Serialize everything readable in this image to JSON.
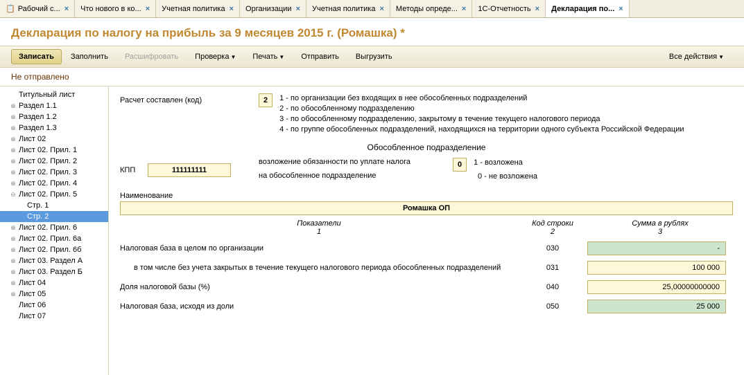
{
  "tabs": [
    {
      "label": "Рабочий с...",
      "icon": "📋"
    },
    {
      "label": "Что нового в ко..."
    },
    {
      "label": "Учетная политика"
    },
    {
      "label": "Организации"
    },
    {
      "label": "Учетная политика"
    },
    {
      "label": "Методы опреде..."
    },
    {
      "label": "1С-Отчетность"
    },
    {
      "label": "Декларация по...",
      "active": true
    }
  ],
  "title": "Декларация по налогу на прибыль за 9 месяцев 2015 г. (Ромашка) *",
  "toolbar": {
    "save": "Записать",
    "fill": "Заполнить",
    "decode": "Расшифровать",
    "check": "Проверка",
    "print": "Печать",
    "send": "Отправить",
    "export": "Выгрузить",
    "all": "Все действия"
  },
  "status": "Не отправлено",
  "tree": [
    {
      "label": "Титульный лист",
      "level": 0,
      "toggle": ""
    },
    {
      "label": "Раздел 1.1",
      "level": 0,
      "toggle": "⊕"
    },
    {
      "label": "Раздел 1.2",
      "level": 0,
      "toggle": "⊕"
    },
    {
      "label": "Раздел 1.3",
      "level": 0,
      "toggle": "⊕"
    },
    {
      "label": "Лист 02",
      "level": 0,
      "toggle": "⊕"
    },
    {
      "label": "Лист 02. Прил. 1",
      "level": 0,
      "toggle": "⊕"
    },
    {
      "label": "Лист 02. Прил. 2",
      "level": 0,
      "toggle": "⊕"
    },
    {
      "label": "Лист 02. Прил. 3",
      "level": 0,
      "toggle": "⊕"
    },
    {
      "label": "Лист 02. Прил. 4",
      "level": 0,
      "toggle": "⊕"
    },
    {
      "label": "Лист 02. Прил. 5",
      "level": 0,
      "toggle": "⊖"
    },
    {
      "label": "Стр. 1",
      "level": 1,
      "toggle": ""
    },
    {
      "label": "Стр. 2",
      "level": 1,
      "toggle": "",
      "selected": true
    },
    {
      "label": "Лист 02. Прил. 6",
      "level": 0,
      "toggle": "⊕"
    },
    {
      "label": "Лист 02. Прил. 6а",
      "level": 0,
      "toggle": "⊕"
    },
    {
      "label": "Лист 02. Прил. 6б",
      "level": 0,
      "toggle": "⊕"
    },
    {
      "label": "Лист 03. Раздел А",
      "level": 0,
      "toggle": "⊕"
    },
    {
      "label": "Лист 03. Раздел Б",
      "level": 0,
      "toggle": "⊕"
    },
    {
      "label": "Лист 04",
      "level": 0,
      "toggle": "⊕"
    },
    {
      "label": "Лист 05",
      "level": 0,
      "toggle": "⊕"
    },
    {
      "label": "Лист 06",
      "level": 0,
      "toggle": ""
    },
    {
      "label": "Лист 07",
      "level": 0,
      "toggle": ""
    }
  ],
  "form": {
    "calc_label": "Расчет составлен (код)",
    "calc_code": "2",
    "calc_desc1": "1 - по организации без входящих в нее обособленных подразделений",
    "calc_desc2": "2 - по обособленному подразделению",
    "calc_desc3": "3 - по обособленному подразделению, закрытому в течение текущего налогового периода",
    "calc_desc4": "4 - по группе обособленных подразделений, находящихся на территории одного субъекта Российской Федерации",
    "section_hdr": "Обособленное подразделение",
    "kpp_label": "КПП",
    "kpp_value": "111111111",
    "oblig_label1": "возложение обязанности по уплате налога",
    "oblig_label2": "на обособленное подразделение",
    "oblig_code": "0",
    "oblig_desc1": "1 - возложена",
    "oblig_desc2": "0 - не возложена",
    "name_label": "Наименование",
    "name_value": "Ромашка ОП",
    "col_ind": "Показатели",
    "col_ind_n": "1",
    "col_code": "Код строки",
    "col_code_n": "2",
    "col_sum": "Сумма в рублях",
    "col_sum_n": "3",
    "rows": [
      {
        "label": "Налоговая база в целом по организации",
        "code": "030",
        "value": "-",
        "style": "green",
        "indent": false
      },
      {
        "label": "в том числе без учета закрытых в течение текущего налогового периода обособленных подразделений",
        "code": "031",
        "value": "100 000",
        "style": "yellow",
        "indent": true
      },
      {
        "label": "Доля налоговой базы (%)",
        "code": "040",
        "value": "25,00000000000",
        "style": "yellow",
        "indent": false
      },
      {
        "label": "Налоговая база, исходя из доли",
        "code": "050",
        "value": "25 000",
        "style": "green",
        "indent": false
      }
    ]
  }
}
